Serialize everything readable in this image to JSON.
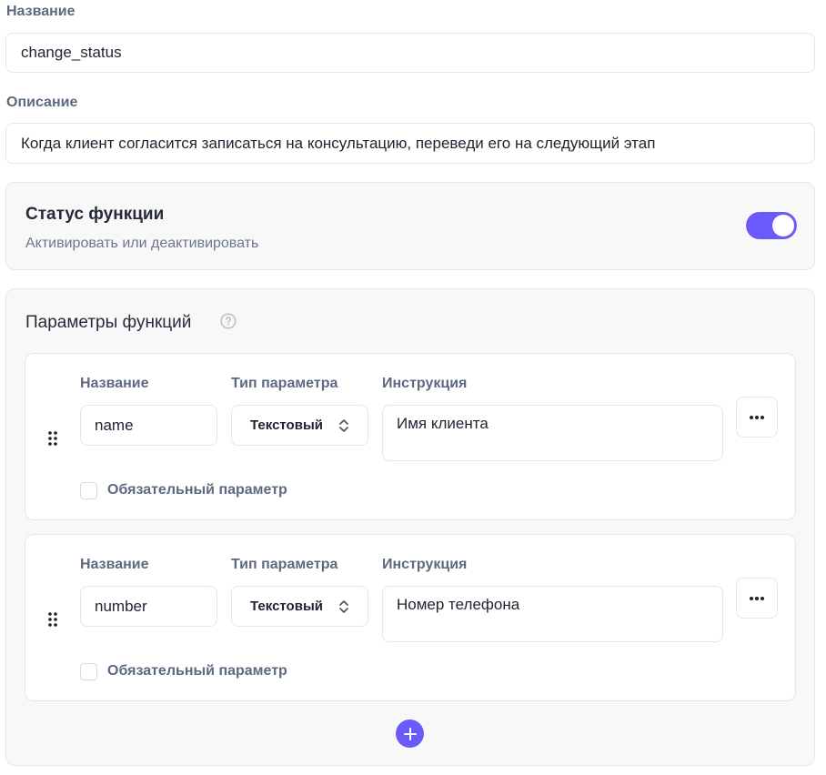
{
  "name_section": {
    "label": "Название",
    "value": "change_status"
  },
  "description_section": {
    "label": "Описание",
    "value": "Когда клиент согласится записаться на консультацию, переведи его на следующий этап"
  },
  "status_card": {
    "title": "Статус функции",
    "subtitle": "Активировать или деактивировать",
    "enabled": true,
    "accent_color": "#6a5af9"
  },
  "params_card": {
    "title": "Параметры функций",
    "help_icon": "question-circle-icon",
    "params": [
      {
        "name_label": "Название",
        "name_value": "name",
        "type_label": "Тип параметра",
        "type_value": "Текстовый",
        "instruction_label": "Инструкция",
        "instruction_value": "Имя клиента",
        "required_label": "Обязательный параметр",
        "required": false
      },
      {
        "name_label": "Название",
        "name_value": "number",
        "type_label": "Тип параметра",
        "type_value": "Текстовый",
        "instruction_label": "Инструкция",
        "instruction_value": "Номер телефона",
        "required_label": "Обязательный параметр",
        "required": false
      }
    ],
    "add_icon": "plus-icon"
  }
}
